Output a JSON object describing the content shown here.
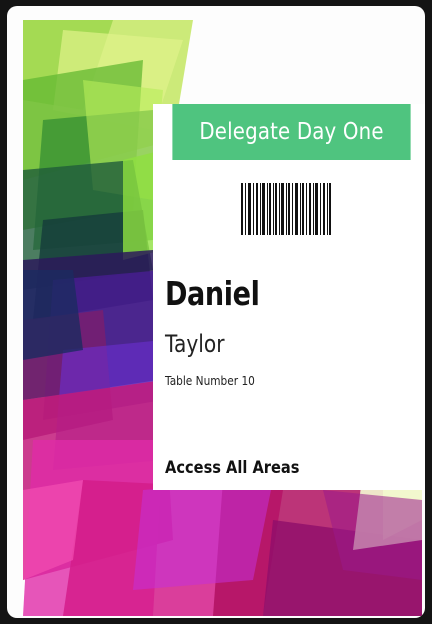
{
  "badge": {
    "title": "Delegate Day One",
    "first_name": "Daniel",
    "last_name": "Taylor",
    "table": "Table Number 10",
    "access": "Access All Areas"
  },
  "colors": {
    "banner": "#4fc47f",
    "background": "#141414",
    "card": "#fdfdfd"
  },
  "icons": {
    "barcode": "barcode-icon"
  }
}
